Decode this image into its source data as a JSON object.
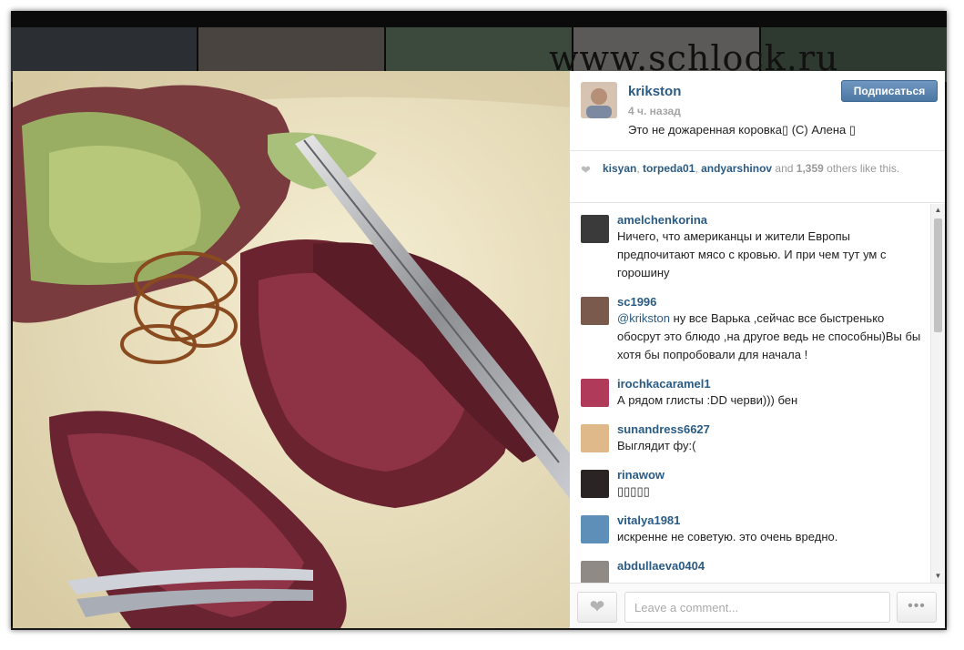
{
  "watermark": "www.schlock.ru",
  "post": {
    "username": "krikston",
    "time_ago": "4 ч. назад",
    "caption": "Это не дожаренная коровка▯ (С) Алена ▯",
    "follow_label": "Подписаться"
  },
  "likes": {
    "likers": [
      "kisyan",
      "torpeda01",
      "andyarshinov"
    ],
    "sep": ", ",
    "and_text": " and ",
    "count": "1,359",
    "suffix": " others like this."
  },
  "comments": [
    {
      "user": "amelchenkorina",
      "text": "Ничего, что американцы и жители Европы предпочитают мясо с кровью. И при чем тут ум с горошину"
    },
    {
      "user": "sc1996",
      "mention": "@krikston",
      "text": " ну все Варька ,сейчас все быстренько обосрут это блюдо ,на другое ведь не способны)Вы бы хотя бы попробовали для начала !"
    },
    {
      "user": "irochkacaramel1",
      "text": "А рядом глисты :DD черви))) бен"
    },
    {
      "user": "sunandress6627",
      "text": "Выглядит фу:("
    },
    {
      "user": "rinawow",
      "text": "▯▯▯▯▯"
    },
    {
      "user": "vitalya1981",
      "text": "искренне не советую. это очень вредно."
    },
    {
      "user": "abdullaeva0404",
      "text": ""
    }
  ],
  "footer": {
    "comment_placeholder": "Leave a comment...",
    "more_label": "•••"
  },
  "icons": {
    "heart": "heart-icon",
    "more": "more-options-icon"
  },
  "colors": {
    "link": "#2a5b84",
    "follow_button": "#5a82ad"
  }
}
